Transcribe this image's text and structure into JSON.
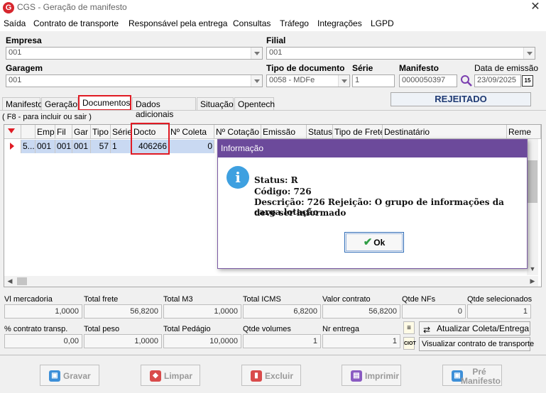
{
  "window": {
    "title": "CGS - Geração de manifesto",
    "logo": "G"
  },
  "menu": [
    "Saída",
    "Contrato de transporte",
    "Responsável pela entrega",
    "Consultas",
    "Tráfego",
    "Integrações",
    "LGPD"
  ],
  "form": {
    "empresa_label": "Empresa",
    "empresa_value": "001",
    "filial_label": "Filial",
    "filial_value": "001",
    "garagem_label": "Garagem",
    "garagem_value": "001",
    "tipo_doc_label": "Tipo de documento",
    "tipo_doc_value": "0058 - MDFe",
    "serie_label": "Série",
    "serie_value": "1",
    "manifesto_label": "Manifesto",
    "manifesto_value": "0000050397",
    "data_emissao_label": "Data de emissão",
    "data_emissao_value": "23/09/2025",
    "calendar_glyph": "15"
  },
  "status": "REJEITADO",
  "tabs": [
    "Manifesto",
    "Geração",
    "Documentos",
    "Dados adicionais",
    "Situação",
    "Opentech"
  ],
  "hint": "( F8 - para incluir ou sair )",
  "grid": {
    "headers": [
      "Emp",
      "Fil",
      "Gar",
      "Tipo",
      "Série",
      "Docto",
      "Nº Coleta",
      "Nº Cotação",
      "Emissão",
      "Status",
      "Tipo de Frete",
      "Destinatário",
      "Reme"
    ],
    "row": {
      "first": "5...",
      "emp": "001",
      "fil": "001",
      "gar": "001",
      "tipo": "57",
      "serie": "1",
      "docto": "406266",
      "coleta": "0"
    }
  },
  "dialog": {
    "title": "Informação",
    "icon": "i",
    "lines": [
      "Status: R",
      "Código: 726",
      "Descrição: 726 Rejeição: O grupo de informações da carga lotação",
      "deve ser informado"
    ],
    "ok_label": "Ok"
  },
  "totals": {
    "row1": [
      {
        "label": "Vl mercadoria",
        "value": "1,0000"
      },
      {
        "label": "Total frete",
        "value": "56,8200"
      },
      {
        "label": "Total M3",
        "value": "1,0000"
      },
      {
        "label": "Total ICMS",
        "value": "6,8200"
      },
      {
        "label": "Valor contrato",
        "value": "56,8200"
      },
      {
        "label": "Qtde NFs",
        "value": "0"
      },
      {
        "label": "Qtde selecionados",
        "value": "1"
      }
    ],
    "row2": [
      {
        "label": "% contrato transp.",
        "value": "0,00"
      },
      {
        "label": "Total peso",
        "value": "1,0000"
      },
      {
        "label": "Total Pedágio",
        "value": "10,0000"
      },
      {
        "label": "Qtde volumes",
        "value": "1"
      },
      {
        "label": "Nr entrega",
        "value": "1"
      }
    ]
  },
  "actions": {
    "atualizar": "Atualizar Coleta/Entrega",
    "visualizar": "Visualizar contrato de transporte",
    "ciot_label": "CIOT"
  },
  "buttons": {
    "gravar": "Gravar",
    "limpar": "Limpar",
    "excluir": "Excluir",
    "imprimir": "Imprimir",
    "pre_manifesto_1": "Pré",
    "pre_manifesto_2": "Manifesto"
  },
  "colors": {
    "accent": "#6c4a9b",
    "highlight": "#e01b24",
    "selection": "#c9d9f2",
    "status_text": "#1f3a74"
  }
}
